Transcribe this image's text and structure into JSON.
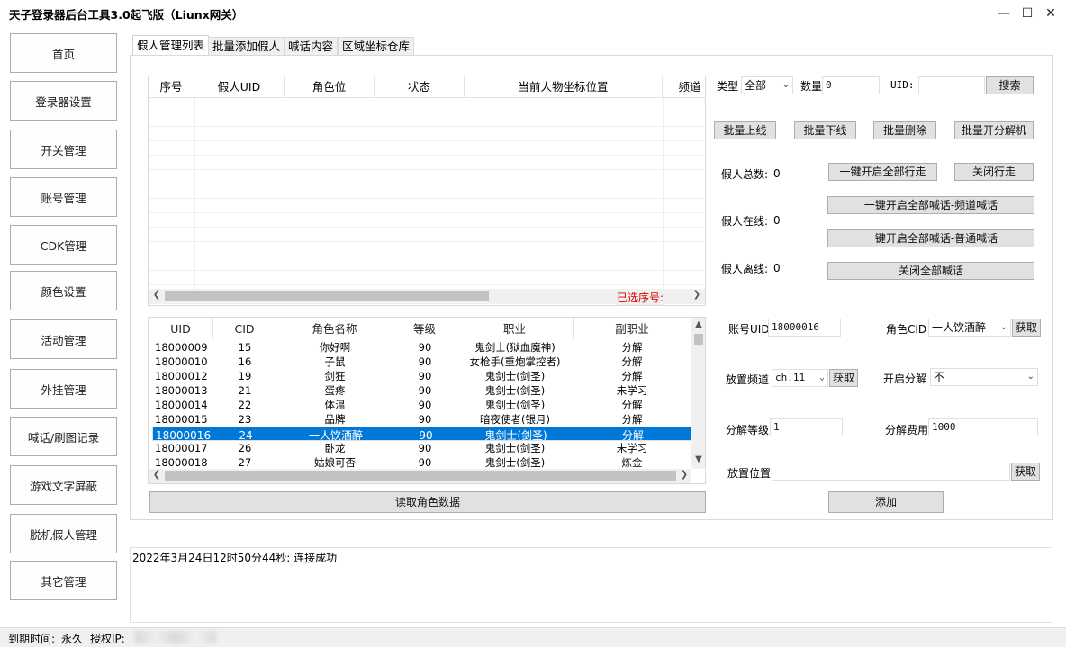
{
  "window": {
    "title": "天子登录器后台工具3.0起飞版（Liunx网关）"
  },
  "nav": [
    "首页",
    "登录器设置",
    "开关管理",
    "账号管理",
    "CDK管理",
    "颜色设置",
    "活动管理",
    "外挂管理",
    "喊话/刷图记录",
    "游戏文字屏蔽",
    "脱机假人管理",
    "其它管理"
  ],
  "tabs": [
    "假人管理列表",
    "批量添加假人",
    "喊话内容",
    "区域坐标仓库"
  ],
  "grid1": {
    "columns": [
      "序号",
      "假人UID",
      "角色位",
      "状态",
      "当前人物坐标位置",
      "频道"
    ],
    "selected_label": "已选序号:"
  },
  "grid2": {
    "columns": [
      "UID",
      "CID",
      "角色名称",
      "等级",
      "职业",
      "副职业"
    ],
    "rows": [
      [
        "18000009",
        "15",
        "你好啊",
        "90",
        "鬼剑士(狱血魔神)",
        "分解"
      ],
      [
        "18000010",
        "16",
        "子鼠",
        "90",
        "女枪手(重炮掌控者)",
        "分解"
      ],
      [
        "18000012",
        "19",
        "剑狂",
        "90",
        "鬼剑士(剑圣)",
        "分解"
      ],
      [
        "18000013",
        "21",
        "蛋疼",
        "90",
        "鬼剑士(剑圣)",
        "未学习"
      ],
      [
        "18000014",
        "22",
        "体温",
        "90",
        "鬼剑士(剑圣)",
        "分解"
      ],
      [
        "18000015",
        "23",
        "品牌",
        "90",
        "暗夜使者(银月)",
        "分解"
      ],
      [
        "18000016",
        "24",
        "一人饮酒醉",
        "90",
        "鬼剑士(剑圣)",
        "分解"
      ],
      [
        "18000017",
        "26",
        "卧龙",
        "90",
        "鬼剑士(剑圣)",
        "未学习"
      ],
      [
        "18000018",
        "27",
        "姑娘可否",
        "90",
        "鬼剑士(剑圣)",
        "炼金"
      ]
    ],
    "selected_index": 6
  },
  "read_button": "读取角色数据",
  "filter": {
    "type_label": "类型",
    "type_value": "全部",
    "count_label": "数量",
    "count_value": "0",
    "uid_label": "UID:",
    "uid_value": "",
    "search_button": "搜索"
  },
  "batch": {
    "online": "批量上线",
    "offline": "批量下线",
    "delete": "批量删除",
    "decompose": "批量开分解机"
  },
  "stats": {
    "total_label": "假人总数:",
    "total_value": "0",
    "online_label": "假人在线:",
    "online_value": "0",
    "offline_label": "假人离线:",
    "offline_value": "0"
  },
  "actions": {
    "walk_on": "一键开启全部行走",
    "walk_off": "关闭行走",
    "shout_channel": "一键开启全部喊话-频道喊话",
    "shout_normal": "一键开启全部喊话-普通喊话",
    "shout_off": "关闭全部喊话"
  },
  "form": {
    "account_label": "账号UID",
    "account_value": "18000016",
    "role_label": "角色CID",
    "role_value": "一人饮酒醉",
    "role_get": "获取",
    "channel_label": "放置频道",
    "channel_value": "ch.11",
    "channel_get": "获取",
    "decompose_label": "开启分解",
    "decompose_value": "不",
    "level_label": "分解等级",
    "level_value": "1",
    "fee_label": "分解费用",
    "fee_value": "1000",
    "position_label": "放置位置",
    "position_value": "",
    "position_get": "获取",
    "add_button": "添加"
  },
  "log": "2022年3月24日12时50分44秒: 连接成功",
  "status": {
    "expire_label": "到期时间:",
    "expire_value": "永久",
    "ip_label": "授权IP:"
  }
}
